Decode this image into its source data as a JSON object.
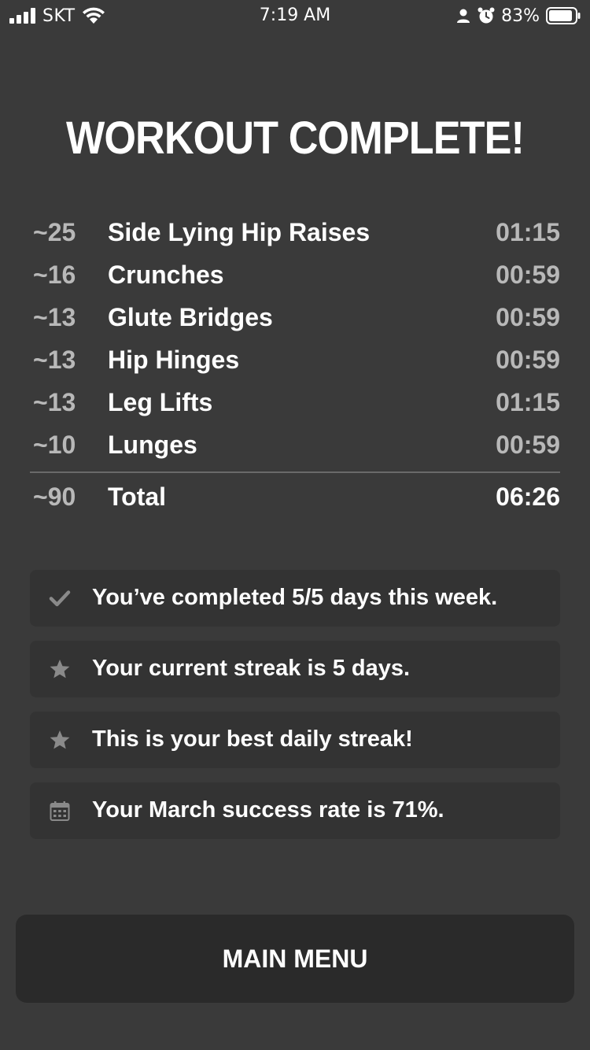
{
  "status_bar": {
    "carrier": "SKT",
    "time": "7:19 AM",
    "battery_percent": "83%",
    "icons": [
      "signal-icon",
      "wifi-icon",
      "person-icon",
      "alarm-icon",
      "battery-icon"
    ]
  },
  "title": "WORKOUT COMPLETE!",
  "exercises": [
    {
      "reps": "~25",
      "name": "Side Lying Hip Raises",
      "time": "01:15"
    },
    {
      "reps": "~16",
      "name": "Crunches",
      "time": "00:59"
    },
    {
      "reps": "~13",
      "name": "Glute Bridges",
      "time": "00:59"
    },
    {
      "reps": "~13",
      "name": "Hip Hinges",
      "time": "00:59"
    },
    {
      "reps": "~13",
      "name": "Leg Lifts",
      "time": "01:15"
    },
    {
      "reps": "~10",
      "name": "Lunges",
      "time": "00:59"
    }
  ],
  "total": {
    "reps": "~90",
    "label": "Total",
    "time": "06:26"
  },
  "stats": [
    {
      "icon": "check-icon",
      "text": "You’ve completed 5/5 days this week."
    },
    {
      "icon": "star-icon",
      "text": "Your current streak is 5 days."
    },
    {
      "icon": "star-icon",
      "text": "This is your best daily streak!"
    },
    {
      "icon": "calendar-icon",
      "text": "Your March success rate is 71%."
    }
  ],
  "main_menu_label": "MAIN MENU",
  "colors": {
    "background": "#3a3a3a",
    "card": "#333333",
    "button": "#2a2a2a",
    "muted_text": "#b8b8b8",
    "icon_gray": "#8a8a8a"
  }
}
